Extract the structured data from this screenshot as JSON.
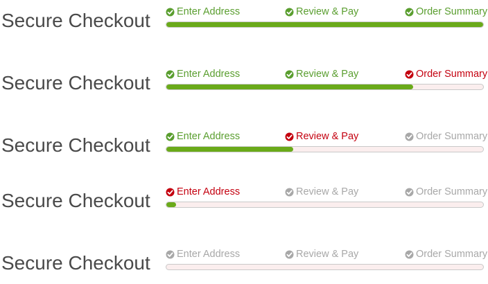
{
  "colors": {
    "complete": "#5a9e2f",
    "current": "#c4000f",
    "pending": "#a8a8a8",
    "bar_fill": "#6aaa1a",
    "bar_track": "#fbeeee"
  },
  "variants": [
    {
      "title": "Secure Checkout",
      "progress": 1.0,
      "steps": [
        {
          "label": "Enter Address",
          "state": "complete",
          "icon": "check-circle-icon"
        },
        {
          "label": "Review & Pay",
          "state": "complete",
          "icon": "check-circle-icon"
        },
        {
          "label": "Order Summary",
          "state": "complete",
          "icon": "check-circle-icon"
        }
      ]
    },
    {
      "title": "Secure Checkout",
      "progress": 0.78,
      "steps": [
        {
          "label": "Enter Address",
          "state": "complete",
          "icon": "check-circle-icon"
        },
        {
          "label": "Review & Pay",
          "state": "complete",
          "icon": "check-circle-icon"
        },
        {
          "label": "Order Summary",
          "state": "current",
          "icon": "check-circle-icon"
        }
      ]
    },
    {
      "title": "Secure Checkout",
      "progress": 0.4,
      "steps": [
        {
          "label": "Enter Address",
          "state": "complete",
          "icon": "check-circle-icon"
        },
        {
          "label": "Review & Pay",
          "state": "current",
          "icon": "check-circle-icon"
        },
        {
          "label": "Order Summary",
          "state": "pending",
          "icon": "check-circle-icon"
        }
      ]
    },
    {
      "title": "Secure Checkout",
      "progress": 0.03,
      "steps": [
        {
          "label": "Enter Address",
          "state": "current",
          "icon": "check-circle-icon"
        },
        {
          "label": "Review & Pay",
          "state": "pending",
          "icon": "check-circle-icon"
        },
        {
          "label": "Order Summary",
          "state": "pending",
          "icon": "check-circle-icon"
        }
      ]
    },
    {
      "title": "Secure Checkout",
      "progress": 0.0,
      "steps": [
        {
          "label": "Enter Address",
          "state": "pending",
          "icon": "check-circle-icon"
        },
        {
          "label": "Review & Pay",
          "state": "pending",
          "icon": "check-circle-icon"
        },
        {
          "label": "Order Summary",
          "state": "pending",
          "icon": "check-circle-icon"
        }
      ]
    }
  ]
}
